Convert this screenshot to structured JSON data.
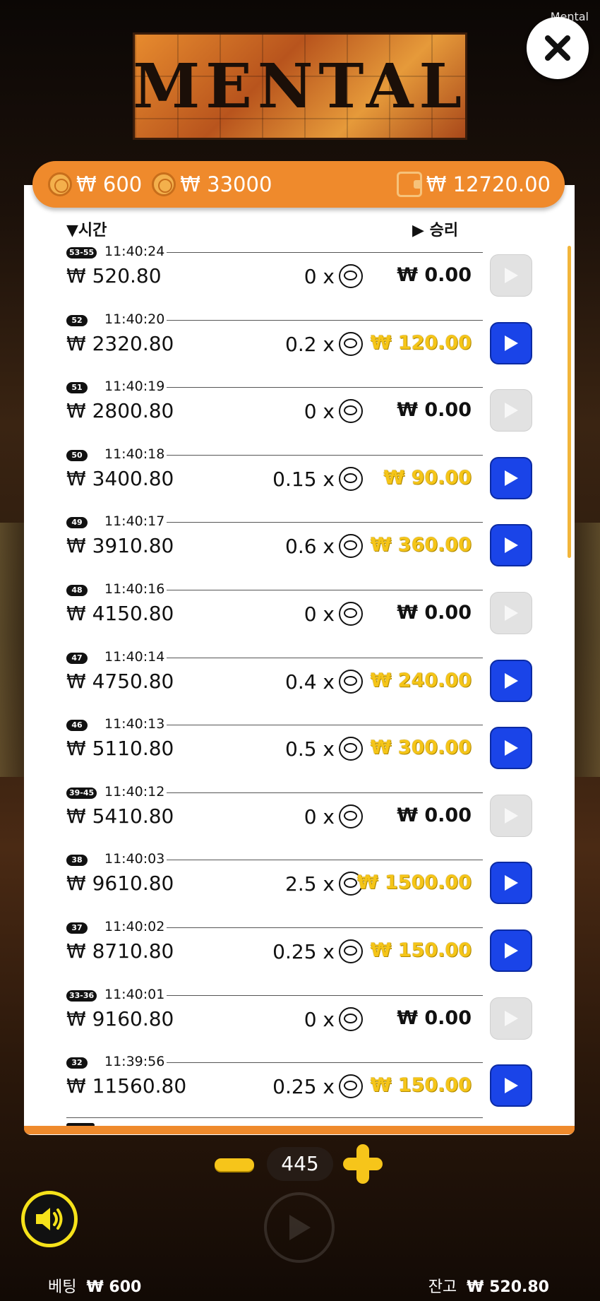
{
  "app_label": "Mental",
  "logo_text": "MENTAL",
  "topbar": {
    "bet_amount": "₩ 600",
    "max_amount": "₩ 33000",
    "balance": "₩ 12720.00"
  },
  "headers": {
    "time": "시간",
    "win": "승리"
  },
  "rows": [
    {
      "round": "53-55",
      "time": "11:40:24",
      "bet": "₩ 520.80",
      "mult": "0 x",
      "win": "₩ 0.00",
      "winning": false
    },
    {
      "round": "52",
      "time": "11:40:20",
      "bet": "₩ 2320.80",
      "mult": "0.2 x",
      "win": "₩ 120.00",
      "winning": true
    },
    {
      "round": "51",
      "time": "11:40:19",
      "bet": "₩ 2800.80",
      "mult": "0 x",
      "win": "₩ 0.00",
      "winning": false
    },
    {
      "round": "50",
      "time": "11:40:18",
      "bet": "₩ 3400.80",
      "mult": "0.15 x",
      "win": "₩ 90.00",
      "winning": true
    },
    {
      "round": "49",
      "time": "11:40:17",
      "bet": "₩ 3910.80",
      "mult": "0.6 x",
      "win": "₩ 360.00",
      "winning": true
    },
    {
      "round": "48",
      "time": "11:40:16",
      "bet": "₩ 4150.80",
      "mult": "0 x",
      "win": "₩ 0.00",
      "winning": false
    },
    {
      "round": "47",
      "time": "11:40:14",
      "bet": "₩ 4750.80",
      "mult": "0.4 x",
      "win": "₩ 240.00",
      "winning": true
    },
    {
      "round": "46",
      "time": "11:40:13",
      "bet": "₩ 5110.80",
      "mult": "0.5 x",
      "win": "₩ 300.00",
      "winning": true
    },
    {
      "round": "39-45",
      "time": "11:40:12",
      "bet": "₩ 5410.80",
      "mult": "0 x",
      "win": "₩ 0.00",
      "winning": false
    },
    {
      "round": "38",
      "time": "11:40:03",
      "bet": "₩ 9610.80",
      "mult": "2.5 x",
      "win": "₩ 1500.00",
      "winning": true
    },
    {
      "round": "37",
      "time": "11:40:02",
      "bet": "₩ 8710.80",
      "mult": "0.25 x",
      "win": "₩ 150.00",
      "winning": true
    },
    {
      "round": "33-36",
      "time": "11:40:01",
      "bet": "₩ 9160.80",
      "mult": "0 x",
      "win": "₩ 0.00",
      "winning": false
    },
    {
      "round": "32",
      "time": "11:39:56",
      "bet": "₩ 11560.80",
      "mult": "0.25 x",
      "win": "₩ 150.00",
      "winning": true
    }
  ],
  "stepper": {
    "value": "445"
  },
  "footer": {
    "bet_label": "베팅",
    "bet_value": "₩ 600",
    "balance_label": "잔고",
    "balance_value": "₩ 520.80"
  },
  "colors": {
    "accent": "#ef8a2c",
    "play_active": "#1a44e8",
    "win_gold": "#f5c518"
  }
}
